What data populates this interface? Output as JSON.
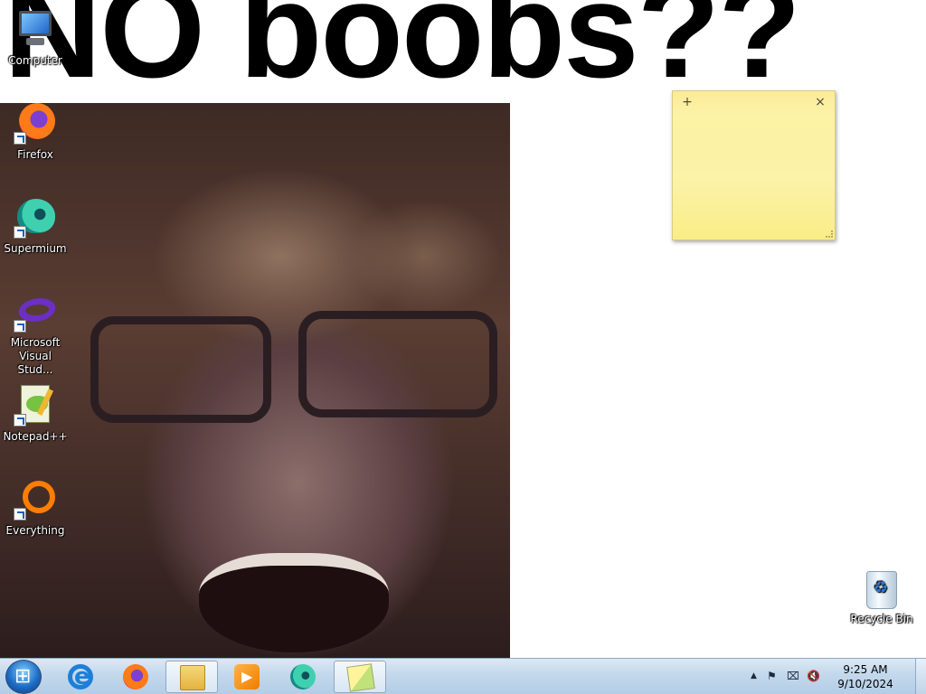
{
  "wallpaper": {
    "caption": "NO boobs??"
  },
  "desktop_icons": [
    {
      "label": "Computer",
      "icon": "computer-icon"
    },
    {
      "label": "Firefox",
      "icon": "firefox-icon"
    },
    {
      "label": "Supermium",
      "icon": "supermium-icon"
    },
    {
      "label": "Microsoft Visual Stud...",
      "icon": "visual-studio-icon"
    },
    {
      "label": "Notepad++",
      "icon": "notepad-plus-plus-icon"
    },
    {
      "label": "Everything",
      "icon": "everything-icon"
    }
  ],
  "recycle_bin": {
    "label": "Recycle Bin",
    "icon": "recycle-bin-icon"
  },
  "sticky_note": {
    "add_glyph": "+",
    "close_glyph": "×",
    "text": ""
  },
  "taskbar": {
    "pinned": [
      {
        "name": "internet-explorer",
        "icon": "internet-explorer-icon",
        "active": false
      },
      {
        "name": "firefox",
        "icon": "firefox-icon",
        "active": false
      },
      {
        "name": "windows-explorer",
        "icon": "folder-icon",
        "active": true
      },
      {
        "name": "windows-media-player",
        "icon": "media-player-icon",
        "active": false
      },
      {
        "name": "supermium",
        "icon": "supermium-icon",
        "active": false
      },
      {
        "name": "sticky-notes",
        "icon": "sticky-notes-icon",
        "active": true
      }
    ],
    "tray": {
      "show_hidden": "▲",
      "flag": "⚑",
      "network": "⌧",
      "volume": "🔇"
    },
    "clock": {
      "time": "9:25 AM",
      "date": "9/10/2024"
    }
  },
  "colors": {
    "taskbar_top": "#dbe9f5",
    "taskbar_bottom": "#b3cde6",
    "sticky_yellow": "#fcf2a8"
  }
}
